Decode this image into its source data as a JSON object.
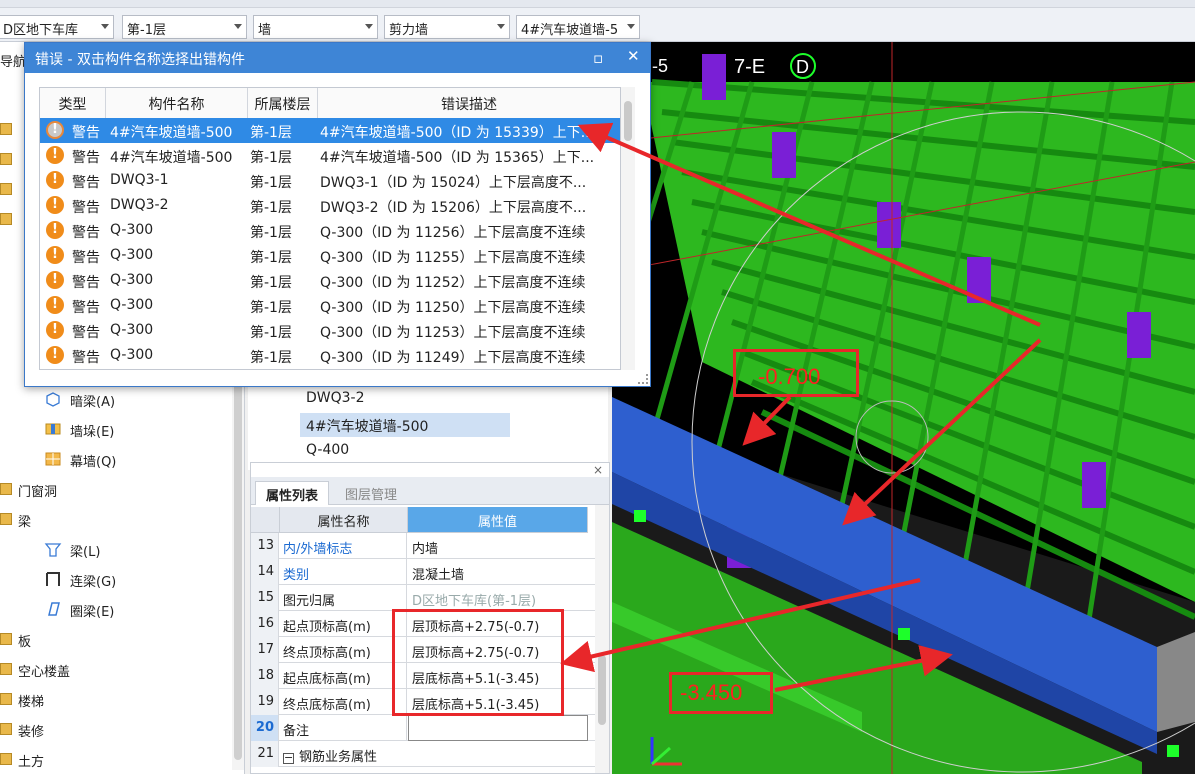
{
  "toolbar": {
    "combos": [
      "D区地下车库",
      "第-1层",
      "墙",
      "剪力墙",
      "4#汽车坡道墙-5"
    ]
  },
  "left_nav": {
    "items": [
      {
        "label": "导航"
      },
      {
        "label": "暗梁(A)"
      },
      {
        "label": "墙垛(E)"
      },
      {
        "label": "幕墙(Q)"
      },
      {
        "label": "门窗洞"
      },
      {
        "label": "梁"
      },
      {
        "label": "梁(L)"
      },
      {
        "label": "连梁(G)"
      },
      {
        "label": "圈梁(E)"
      },
      {
        "label": "板"
      },
      {
        "label": "空心楼盖"
      },
      {
        "label": "楼梯"
      },
      {
        "label": "装修"
      },
      {
        "label": "土方"
      }
    ]
  },
  "mid_list": {
    "items": [
      "DWQ3-2",
      "4#汽车坡道墙-500",
      "Q-400"
    ]
  },
  "properties": {
    "tabs": [
      "属性列表",
      "图层管理"
    ],
    "header_name": "属性名称",
    "header_value": "属性值",
    "rows": [
      {
        "num": "13",
        "name": "内/外墙标志",
        "value": "内墙"
      },
      {
        "num": "14",
        "name": "类别",
        "value": "混凝土墙"
      },
      {
        "num": "15",
        "name": "图元归属",
        "value": "D区地下车库(第-1层)"
      },
      {
        "num": "16",
        "name": "起点顶标高(m)",
        "value": "层顶标高+2.75(-0.7)"
      },
      {
        "num": "17",
        "name": "终点顶标高(m)",
        "value": "层顶标高+2.75(-0.7)"
      },
      {
        "num": "18",
        "name": "起点底标高(m)",
        "value": "层底标高+5.1(-3.45)"
      },
      {
        "num": "19",
        "name": "终点底标高(m)",
        "value": "层底标高+5.1(-3.45)"
      },
      {
        "num": "20",
        "name": "备注",
        "value": ""
      },
      {
        "num": "21",
        "name": "钢筋业务属性",
        "value": ""
      }
    ]
  },
  "dialog": {
    "title": "错误 - 双击构件名称选择出错构件",
    "columns": [
      "类型",
      "构件名称",
      "所属楼层",
      "错误描述"
    ],
    "rows": [
      {
        "type": "警告",
        "name": "4#汽车坡道墙-500",
        "floor": "第-1层",
        "desc": "4#汽车坡道墙-500（ID 为 15339）上下..."
      },
      {
        "type": "警告",
        "name": "4#汽车坡道墙-500",
        "floor": "第-1层",
        "desc": "4#汽车坡道墙-500（ID 为 15365）上下..."
      },
      {
        "type": "警告",
        "name": "DWQ3-1",
        "floor": "第-1层",
        "desc": "DWQ3-1（ID 为 15024）上下层高度不..."
      },
      {
        "type": "警告",
        "name": "DWQ3-2",
        "floor": "第-1层",
        "desc": "DWQ3-2（ID 为 15206）上下层高度不..."
      },
      {
        "type": "警告",
        "name": "Q-300",
        "floor": "第-1层",
        "desc": "Q-300（ID 为 11256）上下层高度不连续"
      },
      {
        "type": "警告",
        "name": "Q-300",
        "floor": "第-1层",
        "desc": "Q-300（ID 为 11255）上下层高度不连续"
      },
      {
        "type": "警告",
        "name": "Q-300",
        "floor": "第-1层",
        "desc": "Q-300（ID 为 11252）上下层高度不连续"
      },
      {
        "type": "警告",
        "name": "Q-300",
        "floor": "第-1层",
        "desc": "Q-300（ID 为 11250）上下层高度不连续"
      },
      {
        "type": "警告",
        "name": "Q-300",
        "floor": "第-1层",
        "desc": "Q-300（ID 为 11253）上下层高度不连续"
      },
      {
        "type": "警告",
        "name": "Q-300",
        "floor": "第-1层",
        "desc": "Q-300（ID 为 11249）上下层高度不连续"
      }
    ]
  },
  "viewport": {
    "axis_labels": [
      "-5",
      "7-E",
      "D"
    ],
    "callout_top": "-0.700",
    "callout_bottom": "-3.450"
  },
  "colors": {
    "accent": "#3e85d6",
    "selection": "#2f8ae5",
    "warning": "#f08c1a",
    "callout": "#e8272a",
    "beam_green": "#2fcf1f",
    "wall_blue": "#2e5fcf",
    "column_purple": "#7a1fd6"
  }
}
